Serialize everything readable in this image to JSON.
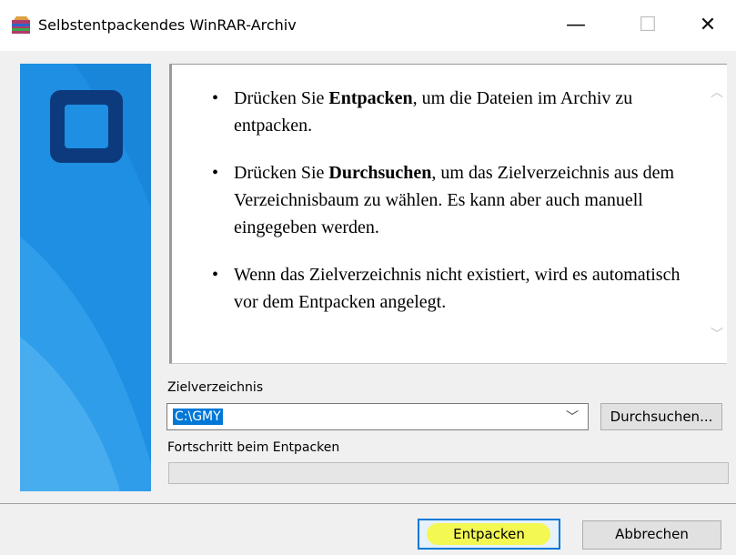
{
  "window": {
    "title": "Selbstentpackendes WinRAR-Archiv",
    "icons": {
      "app": "winrar-archive-icon",
      "minimize": "minimize-icon",
      "maximize": "maximize-icon",
      "close": "close-icon"
    },
    "controls": {
      "minimize": "—",
      "maximize": "☐",
      "close": "✕"
    }
  },
  "banner": {
    "icon": "winrar-logo-square-icon",
    "colors": {
      "background": "#1e8fe3",
      "square": "#0c3a7c"
    }
  },
  "info": {
    "items": [
      {
        "before": "Drücken Sie ",
        "bold": "Entpacken",
        "after": ", um die Dateien im Archiv zu entpacken."
      },
      {
        "before": "Drücken Sie ",
        "bold": "Durchsuchen",
        "after": ", um das Zielverzeichnis aus dem Verzeichnisbaum zu wählen. Es kann aber auch manuell eingegeben werden."
      },
      {
        "before": "Wenn das Zielverzeichnis nicht existiert, wird es automatisch vor dem Entpacken angelegt.",
        "bold": "",
        "after": ""
      }
    ]
  },
  "target": {
    "label": "Zielverzeichnis",
    "value": "C:\\GMY"
  },
  "browse_button": "Durchsuchen...",
  "progress": {
    "label": "Fortschritt beim Entpacken",
    "value": 0
  },
  "buttons": {
    "extract": "Entpacken",
    "cancel": "Abbrechen"
  },
  "colors": {
    "accent": "#0078d7",
    "highlight": "#f3f84a"
  }
}
